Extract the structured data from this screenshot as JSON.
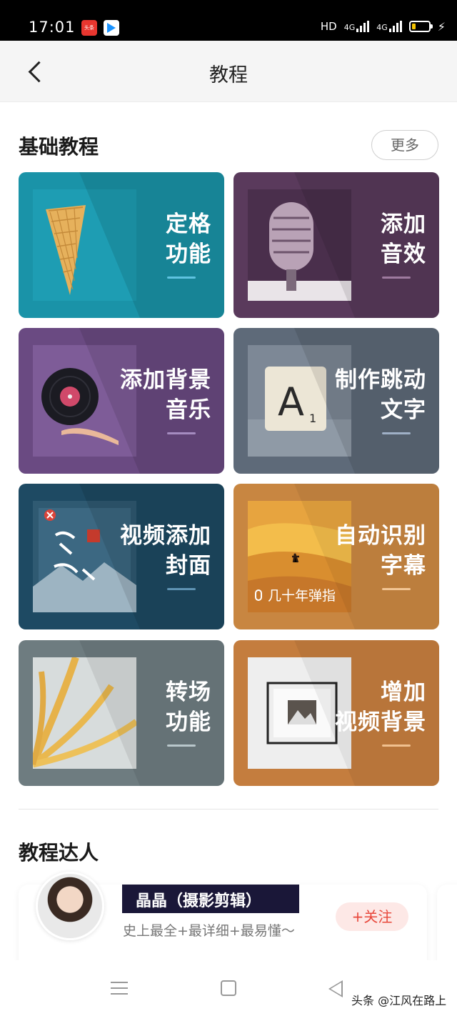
{
  "status_bar": {
    "time": "17:01",
    "network_label": "HD",
    "signal_1": "4G",
    "signal_2": "4G",
    "app_icon_1": "toutiao-app-icon",
    "app_icon_2": "youku-app-icon",
    "app_icon_1_text": "头条"
  },
  "header": {
    "title": "教程",
    "back_icon": "chevron-left-icon"
  },
  "basic_section": {
    "title": "基础教程",
    "more_label": "更多",
    "cards": [
      {
        "label": "定格\n功能",
        "color": "#1a93a8",
        "underline": "#5fc3e0"
      },
      {
        "label": "添加\n音效",
        "color": "#5a3a5c",
        "underline": "#9e7a9f"
      },
      {
        "label": "添加背景\n音乐",
        "color": "#6a4a82",
        "underline": "#a58cc0"
      },
      {
        "label": "制作跳动\n文字",
        "color": "#5e6a79",
        "underline": "#9fb0c6"
      },
      {
        "label": "视频添加\n封面",
        "color": "#1e4a63",
        "underline": "#5f93b3"
      },
      {
        "label": "自动识别\n字幕",
        "color": "#c88641",
        "underline": "#f2c594"
      },
      {
        "label": "转场\n功能",
        "color": "#6e7c80",
        "underline": "#b9c7cb"
      },
      {
        "label": "增加\n视频背景",
        "color": "#c47d3e",
        "underline": "#f0c08f"
      }
    ],
    "subtitle_overlay": "几十年弹指"
  },
  "experts_section": {
    "title": "教程达人",
    "experts": [
      {
        "name": "晶晶（摄影剪辑）",
        "description": "史上最全+最详细+最易懂～",
        "follow_label": "+关注"
      }
    ]
  },
  "watermark": "头条 @江风在路上"
}
